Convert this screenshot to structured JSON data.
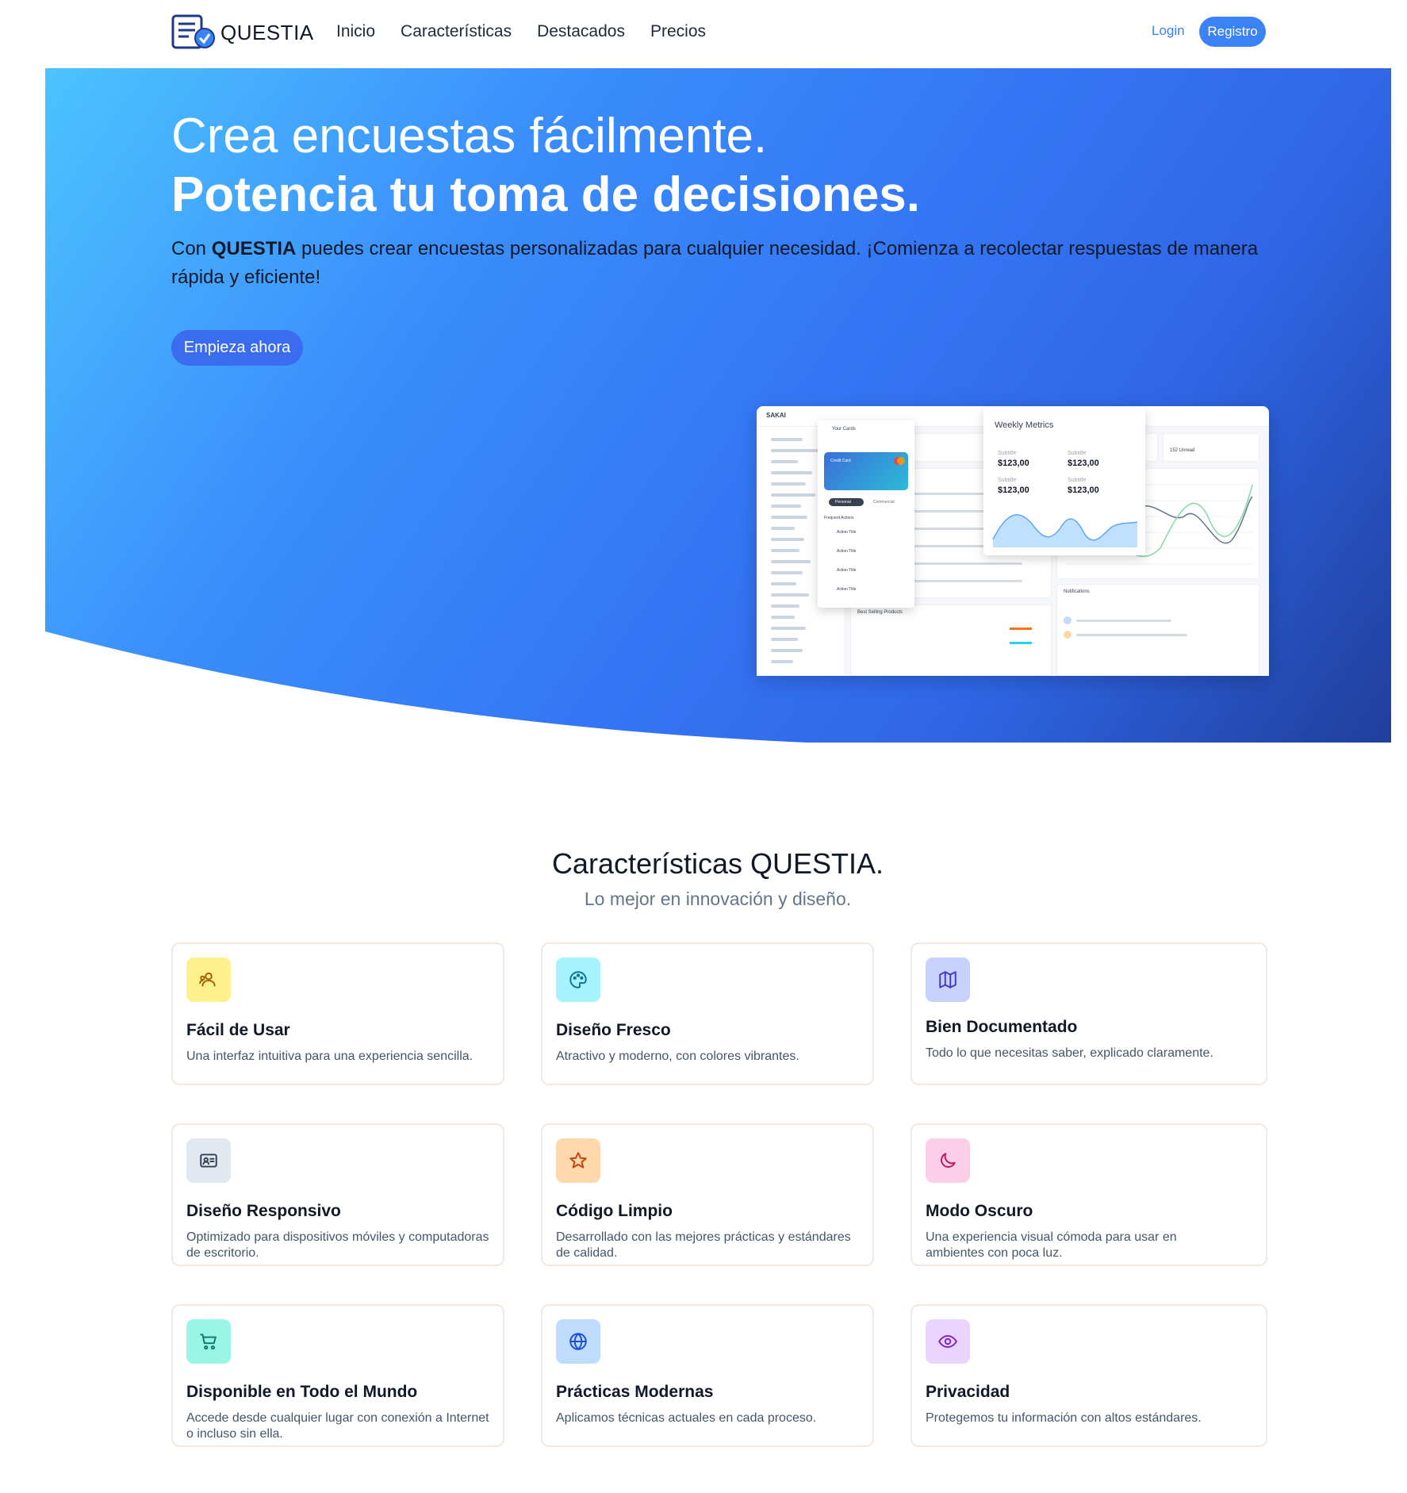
{
  "nav": {
    "brand": "QUESTIA",
    "links": [
      "Inicio",
      "Características",
      "Destacados",
      "Precios"
    ],
    "login": "Login",
    "register": "Registro"
  },
  "hero": {
    "headline_1": "Crea encuestas fácilmente.",
    "headline_2": "Potencia tu toma de decisiones.",
    "para_pre": "Con ",
    "para_brand": "QUESTIA",
    "para_post": " puedes crear encuestas personalizadas para cualquier necesidad. ¡Comienza a recolectar respuestas de manera rápida y eficiente!",
    "cta": "Empieza ahora"
  },
  "mockup": {
    "brand": "SAKAI",
    "cards_title": "Your Cards",
    "card_label": "Credit Card",
    "tab_personal": "Personal",
    "tab_commercial": "Commercial",
    "frequent": "Frequent Actions",
    "action": "Action Title",
    "metrics_title": "Weekly Metrics",
    "metric_label": "Subtitle",
    "metric_value": "$123,00",
    "unread": "152 Unread",
    "best_selling": "Best Selling Products",
    "notifications": "Notifications"
  },
  "features": {
    "title": "Características QUESTIA.",
    "subtitle": "Lo mejor en innovación y diseño.",
    "items": [
      {
        "title": "Fácil de Usar",
        "desc": "Una interfaz intuitiva para una experiencia sencilla.",
        "icon": "users-icon",
        "bg": "#fef08a",
        "color": "#a16207"
      },
      {
        "title": "Diseño Fresco",
        "desc": "Atractivo y moderno, con colores vibrantes.",
        "icon": "palette-icon",
        "bg": "#a5f3fc",
        "color": "#0e7490"
      },
      {
        "title": "Bien Documentado",
        "desc": "Todo lo que necesitas saber, explicado claramente.",
        "icon": "map-icon",
        "bg": "#c7d2fe",
        "color": "#4338ca"
      },
      {
        "title": "Diseño Responsivo",
        "desc": "Optimizado para dispositivos móviles y computadoras de escritorio.",
        "icon": "id-card-icon",
        "bg": "#e2e8f0",
        "color": "#334155"
      },
      {
        "title": "Código Limpio",
        "desc": "Desarrollado con las mejores prácticas y estándares de calidad.",
        "icon": "star-icon",
        "bg": "#fed7aa",
        "color": "#c2410c"
      },
      {
        "title": "Modo Oscuro",
        "desc": "Una experiencia visual cómoda para usar en ambientes con poca luz.",
        "icon": "moon-icon",
        "bg": "#fbcfe8",
        "color": "#be185d"
      },
      {
        "title": "Disponible en Todo el Mundo",
        "desc": "Accede desde cualquier lugar con conexión a Internet o incluso sin ella.",
        "icon": "cart-icon",
        "bg": "#99f6e4",
        "color": "#0f766e"
      },
      {
        "title": "Prácticas Modernas",
        "desc": "Aplicamos técnicas actuales en cada proceso.",
        "icon": "globe-icon",
        "bg": "#bfdbfe",
        "color": "#1d4ed8"
      },
      {
        "title": "Privacidad",
        "desc": "Protegemos tu información con altos estándares.",
        "icon": "eye-icon",
        "bg": "#e9d5ff",
        "color": "#7e22ce"
      }
    ]
  }
}
